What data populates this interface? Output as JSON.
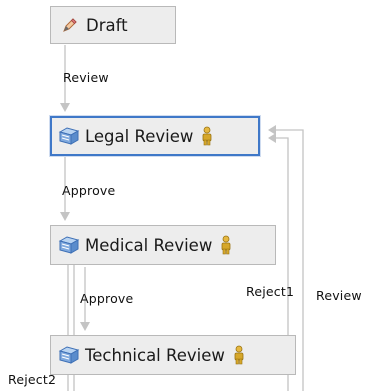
{
  "nodes": {
    "draft": {
      "label": "Draft",
      "icon": "pencil-icon"
    },
    "legal": {
      "label": "Legal Review",
      "icon": "task-box-icon",
      "assignee_icon": "user-icon"
    },
    "medical": {
      "label": "Medical Review",
      "icon": "task-box-icon",
      "assignee_icon": "user-icon"
    },
    "technical": {
      "label": "Technical Review",
      "icon": "task-box-icon",
      "assignee_icon": "user-icon"
    }
  },
  "edges": {
    "draft_to_legal": "Review",
    "legal_to_medical": "Approve",
    "medical_to_technical": "Approve",
    "reject1": "Reject1",
    "review_back": "Review",
    "reject2": "Reject2"
  },
  "colors": {
    "node_fill": "#ededed",
    "node_border": "#b9b9b9",
    "selected_border": "#3f78c8",
    "connector": "#c4c4c4",
    "person_body": "#d6a72a"
  }
}
